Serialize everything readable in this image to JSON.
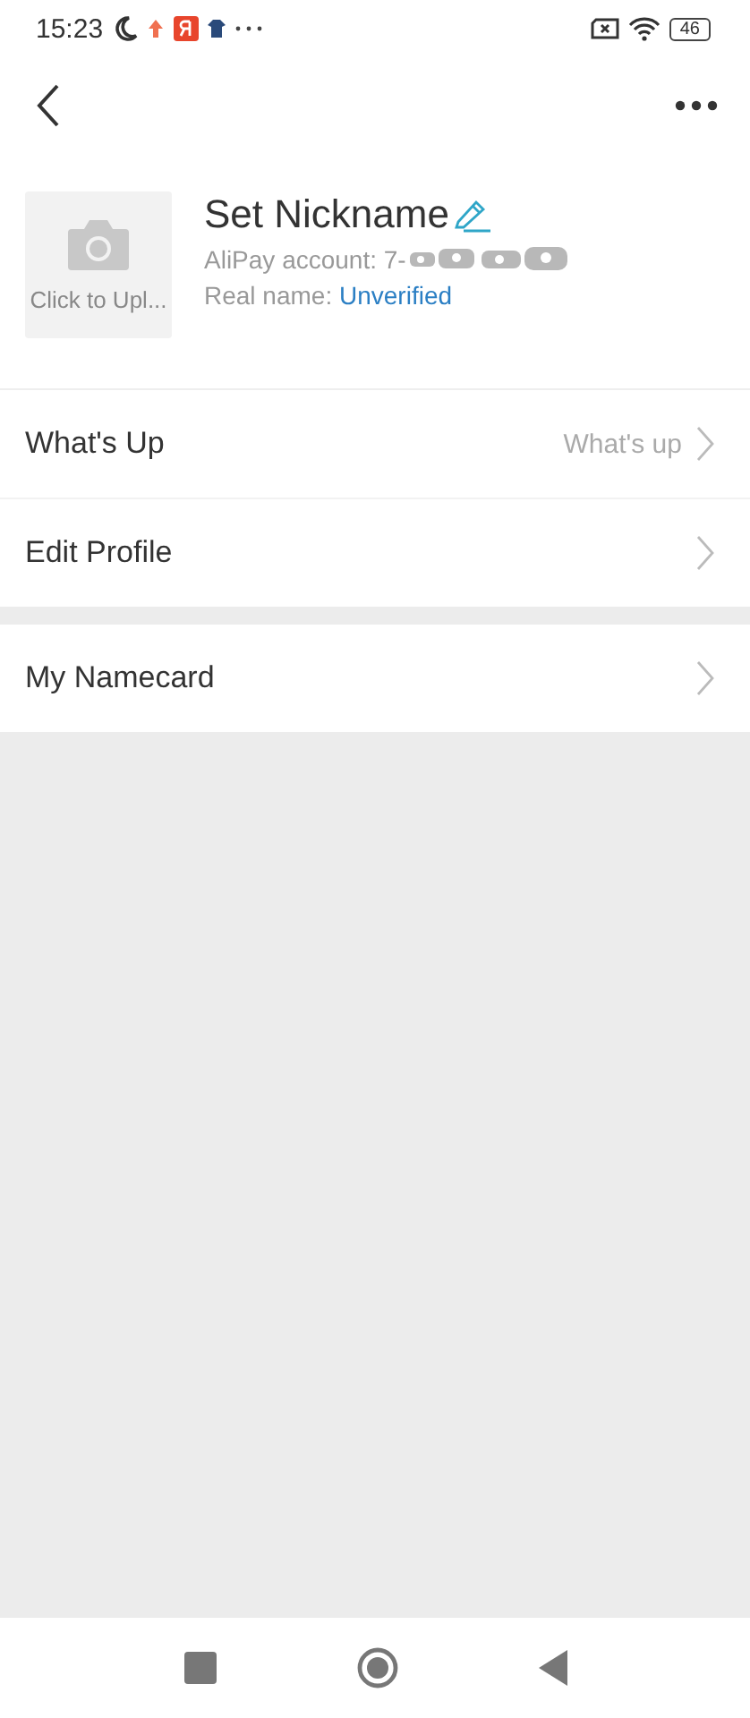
{
  "status_bar": {
    "time": "15:23",
    "battery": "46"
  },
  "profile": {
    "avatar_label": "Click to Upl...",
    "nickname": "Set Nickname",
    "account_label": "AliPay account: 7-",
    "real_name_label": "Real name: ",
    "real_name_value": "Unverified"
  },
  "groups": [
    {
      "rows": [
        {
          "label": "What's Up",
          "value": "What's up"
        },
        {
          "label": "Edit Profile"
        }
      ]
    },
    {
      "rows": [
        {
          "label": "My Namecard"
        }
      ]
    }
  ]
}
